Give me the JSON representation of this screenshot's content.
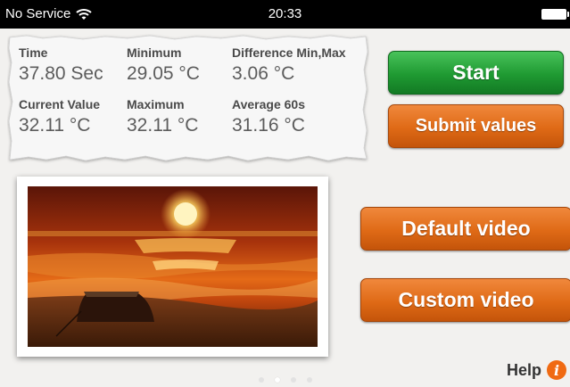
{
  "status_bar": {
    "carrier": "No Service",
    "time": "20:33"
  },
  "stats": {
    "time": {
      "label": "Time",
      "value": "37.80 Sec"
    },
    "minimum": {
      "label": "Minimum",
      "value": "29.05 °C"
    },
    "difference": {
      "label": "Difference Min,Max",
      "value": "3.06 °C"
    },
    "current": {
      "label": "Current Value",
      "value": "32.11 °C"
    },
    "maximum": {
      "label": "Maximum",
      "value": "32.11 °C"
    },
    "average": {
      "label": "Average 60s",
      "value": "31.16 °C"
    }
  },
  "buttons": {
    "start": "Start",
    "submit": "Submit values",
    "default_video": "Default video",
    "custom_video": "Custom video"
  },
  "pager": {
    "count": 4,
    "active": 2
  },
  "help": {
    "label": "Help",
    "icon": "info-icon"
  },
  "colors": {
    "start_button": "#1f9a32",
    "action_button": "#df6a16",
    "info_icon": "#f06a12"
  }
}
